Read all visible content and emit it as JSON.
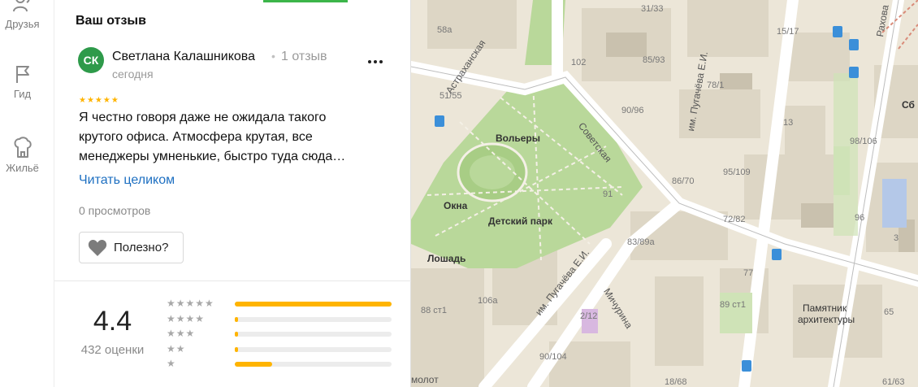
{
  "nav": {
    "items": [
      {
        "label": "Друзья",
        "icon": "friends-icon"
      },
      {
        "label": "Гид",
        "icon": "flag-icon"
      },
      {
        "label": "Жильё",
        "icon": "housing-icon"
      }
    ]
  },
  "review": {
    "section_title": "Ваш отзыв",
    "avatar_initials": "СК",
    "author": "Светлана Калашникова",
    "count_label": "1 отзыв",
    "date": "сегодня",
    "stars": 5,
    "text_lines": [
      "Я честно говоря даже не ожидала такого",
      "крутого офиса. Атмосфера крутая, все",
      "менеджеры умненькие, быстро туда сюда…"
    ],
    "read_more": "Читать целиком",
    "views": "0 просмотров",
    "useful_label": "Полезно?"
  },
  "rating": {
    "value": "4.4",
    "count": "432 оценки",
    "distribution": [
      {
        "stars": 5,
        "fraction": 1.0
      },
      {
        "stars": 4,
        "fraction": 0.02
      },
      {
        "stars": 3,
        "fraction": 0.02
      },
      {
        "stars": 2,
        "fraction": 0.02
      },
      {
        "stars": 1,
        "fraction": 0.24
      }
    ]
  },
  "map": {
    "labels": {
      "park": "Детский парк",
      "volery": "Вольеры",
      "okna": "Окна",
      "loshad": "Лошадь",
      "astrakhanskaya": "Астраханская",
      "sovetskaya": "Советская",
      "pugacheva1": "им. Пугачёва Е.И.",
      "pugacheva2": "им. Пугачёва Е.И.",
      "michurina": "Мичурина",
      "rakhova": "Рахова",
      "monument": "Памятник",
      "monument2": "архитектуры",
      "molot": "молот",
      "sb": "Сб",
      "house_31_33": "31/33",
      "house_58a": "58а",
      "house_102": "102",
      "house_85_93": "85/93",
      "house_15_17": "15/17",
      "house_78_1": "78/1",
      "house_51_55": "51/55",
      "house_90_96": "90/96",
      "house_13": "13",
      "house_98_106": "98/106",
      "house_95_109": "95/109",
      "house_86_70": "86/70",
      "house_91": "91",
      "house_72_82": "72/82",
      "house_96": "96",
      "house_3": "3",
      "house_83_89a": "83/89а",
      "house_77": "77",
      "house_89_st1": "89 ст1",
      "house_65": "65",
      "house_88_st1": "88 ст1",
      "house_106a": "106а",
      "house_2_12": "2/12",
      "house_90_104": "90/104",
      "house_18_68": "18/68",
      "house_61_63": "61/63"
    }
  }
}
